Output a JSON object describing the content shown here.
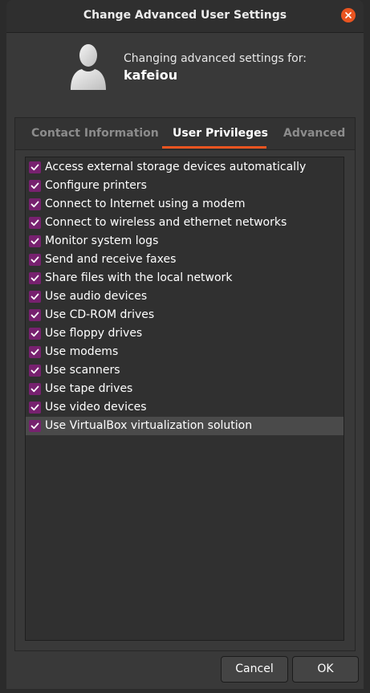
{
  "window": {
    "title": "Change Advanced User Settings"
  },
  "header": {
    "subtitle": "Changing advanced settings for:",
    "username": "kafeiou"
  },
  "tabs": [
    {
      "label": "Contact Information",
      "active": false
    },
    {
      "label": "User Privileges",
      "active": true
    },
    {
      "label": "Advanced",
      "active": false
    }
  ],
  "privileges": [
    {
      "label": "Access external storage devices automatically",
      "checked": true
    },
    {
      "label": "Configure printers",
      "checked": true
    },
    {
      "label": "Connect to Internet using a modem",
      "checked": true
    },
    {
      "label": "Connect to wireless and ethernet networks",
      "checked": true
    },
    {
      "label": "Monitor system logs",
      "checked": true
    },
    {
      "label": "Send and receive faxes",
      "checked": true
    },
    {
      "label": "Share files with the local network",
      "checked": true
    },
    {
      "label": "Use audio devices",
      "checked": true
    },
    {
      "label": "Use CD-ROM drives",
      "checked": true
    },
    {
      "label": "Use floppy drives",
      "checked": true
    },
    {
      "label": "Use modems",
      "checked": true
    },
    {
      "label": "Use scanners",
      "checked": true
    },
    {
      "label": "Use tape drives",
      "checked": true
    },
    {
      "label": "Use video devices",
      "checked": true
    },
    {
      "label": "Use VirtualBox virtualization solution",
      "checked": true,
      "selected": true
    }
  ],
  "buttons": {
    "cancel": "Cancel",
    "ok": "OK"
  },
  "colors": {
    "accent": "#e95420",
    "checkbox": "#77216f",
    "background": "#393939"
  }
}
